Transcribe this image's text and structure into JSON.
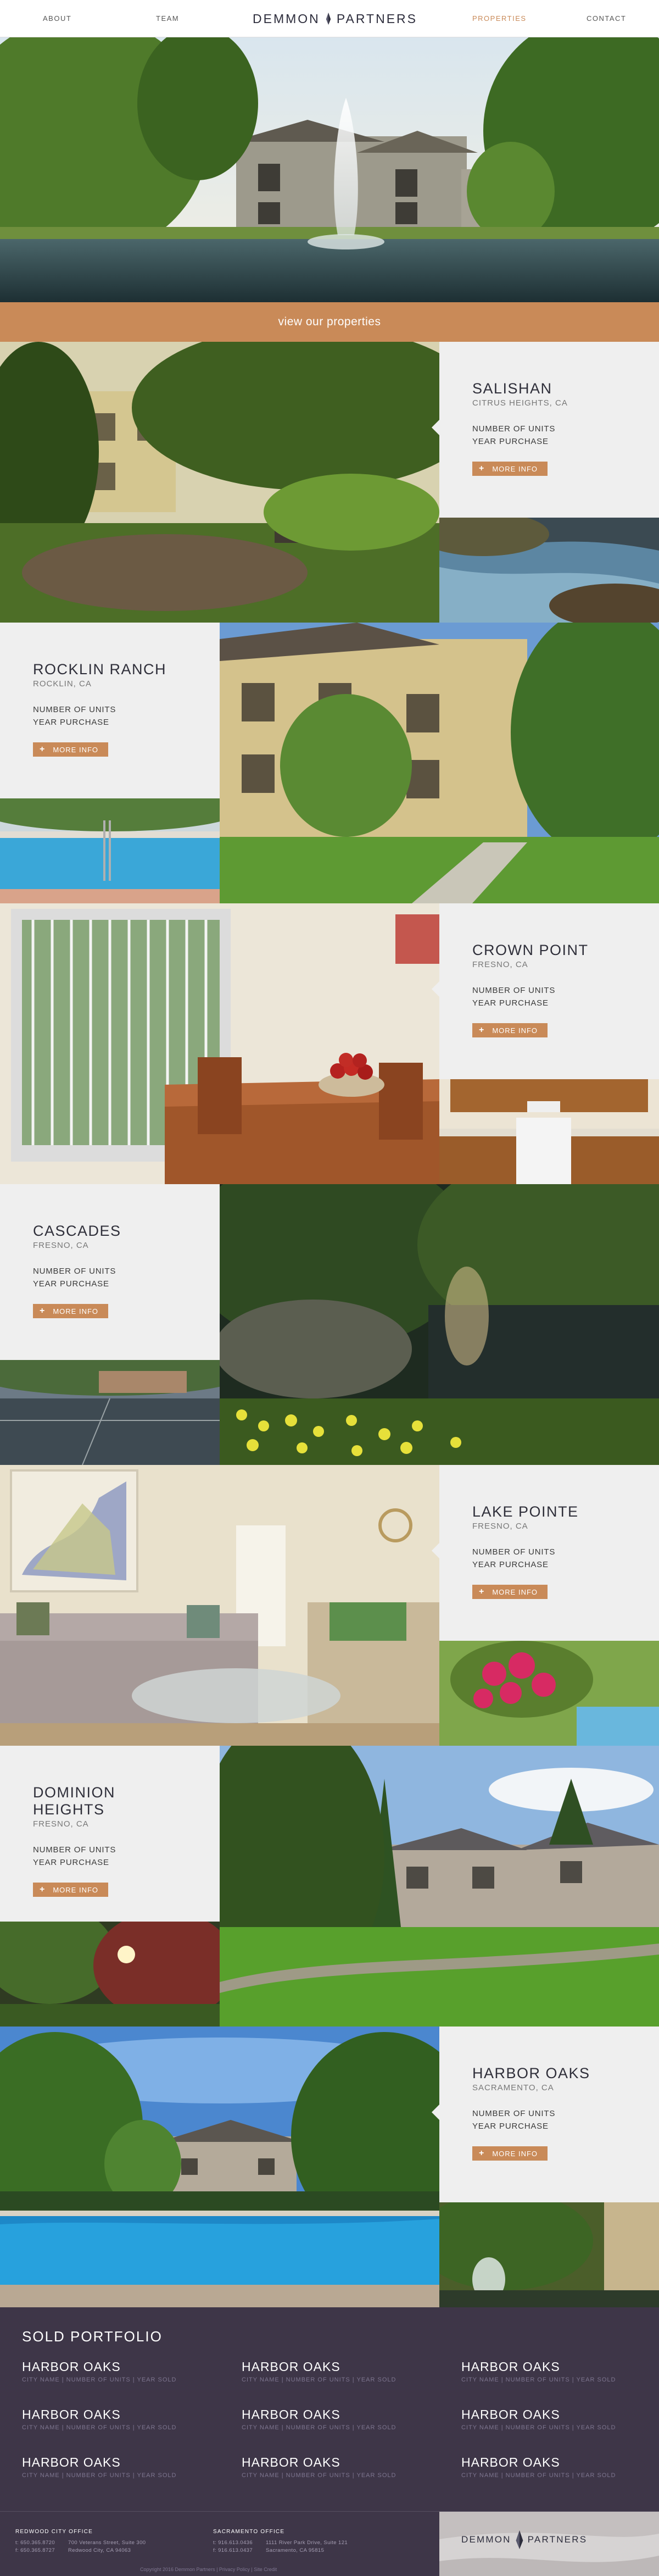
{
  "nav": {
    "about": "ABOUT",
    "team": "TEAM",
    "properties": "PROPERTIES",
    "contact": "CONTACT"
  },
  "brand": {
    "left": "DEMMON",
    "right": "PARTNERS"
  },
  "hero": {
    "cta": "view our properties"
  },
  "property_fields": {
    "units_label": "NUMBER OF UNITS",
    "year_label": "YEAR PURCHASE",
    "more_label": "MORE INFO",
    "more_icon": "plus-icon"
  },
  "properties": [
    {
      "name": "SALISHAN",
      "city": "CITRUS HEIGHTS, CA"
    },
    {
      "name": "ROCKLIN RANCH",
      "city": "ROCKLIN, CA"
    },
    {
      "name": "CROWN POINT",
      "city": "FRESNO, CA"
    },
    {
      "name": "CASCADES",
      "city": "FRESNO, CA"
    },
    {
      "name": "LAKE POINTE",
      "city": "FRESNO, CA"
    },
    {
      "name": "DOMINION HEIGHTS",
      "city": "FRESNO, CA"
    },
    {
      "name": "HARBOR OAKS",
      "city": "SACRAMENTO, CA"
    }
  ],
  "sold": {
    "title": "SOLD PORTFOLIO",
    "items": [
      {
        "name": "HARBOR OAKS",
        "meta": "CITY NAME | NUMBER OF UNITS | YEAR SOLD"
      },
      {
        "name": "HARBOR OAKS",
        "meta": "CITY NAME | NUMBER OF UNITS | YEAR SOLD"
      },
      {
        "name": "HARBOR OAKS",
        "meta": "CITY NAME | NUMBER OF UNITS | YEAR SOLD"
      },
      {
        "name": "HARBOR OAKS",
        "meta": "CITY NAME | NUMBER OF UNITS | YEAR SOLD"
      },
      {
        "name": "HARBOR OAKS",
        "meta": "CITY NAME | NUMBER OF UNITS | YEAR SOLD"
      },
      {
        "name": "HARBOR OAKS",
        "meta": "CITY NAME | NUMBER OF UNITS | YEAR SOLD"
      },
      {
        "name": "HARBOR OAKS",
        "meta": "CITY NAME | NUMBER OF UNITS | YEAR SOLD"
      },
      {
        "name": "HARBOR OAKS",
        "meta": "CITY NAME | NUMBER OF UNITS | YEAR SOLD"
      },
      {
        "name": "HARBOR OAKS",
        "meta": "CITY NAME | NUMBER OF UNITS | YEAR SOLD"
      }
    ]
  },
  "footer": {
    "office1": {
      "title": "REDWOOD CITY OFFICE",
      "phone": "t: 650.365.8720",
      "fax": "f: 650.365.8727",
      "street": "700 Veterans Street, Suite 300",
      "city": "Redwood City, CA 94063"
    },
    "office2": {
      "title": "SACRAMENTO OFFICE",
      "phone": "t: 916.613.0436",
      "fax": "f: 916.613.0437",
      "street": "1111 River Park Drive, Suite 121",
      "city": "Sacramento, CA 95815"
    },
    "copyright": "Copyright 2016 Demmon Partners | Privacy Policy | Site Credit"
  },
  "colors": {
    "accent": "#c98a58",
    "dark": "#3e3648",
    "panel": "#efefef"
  }
}
